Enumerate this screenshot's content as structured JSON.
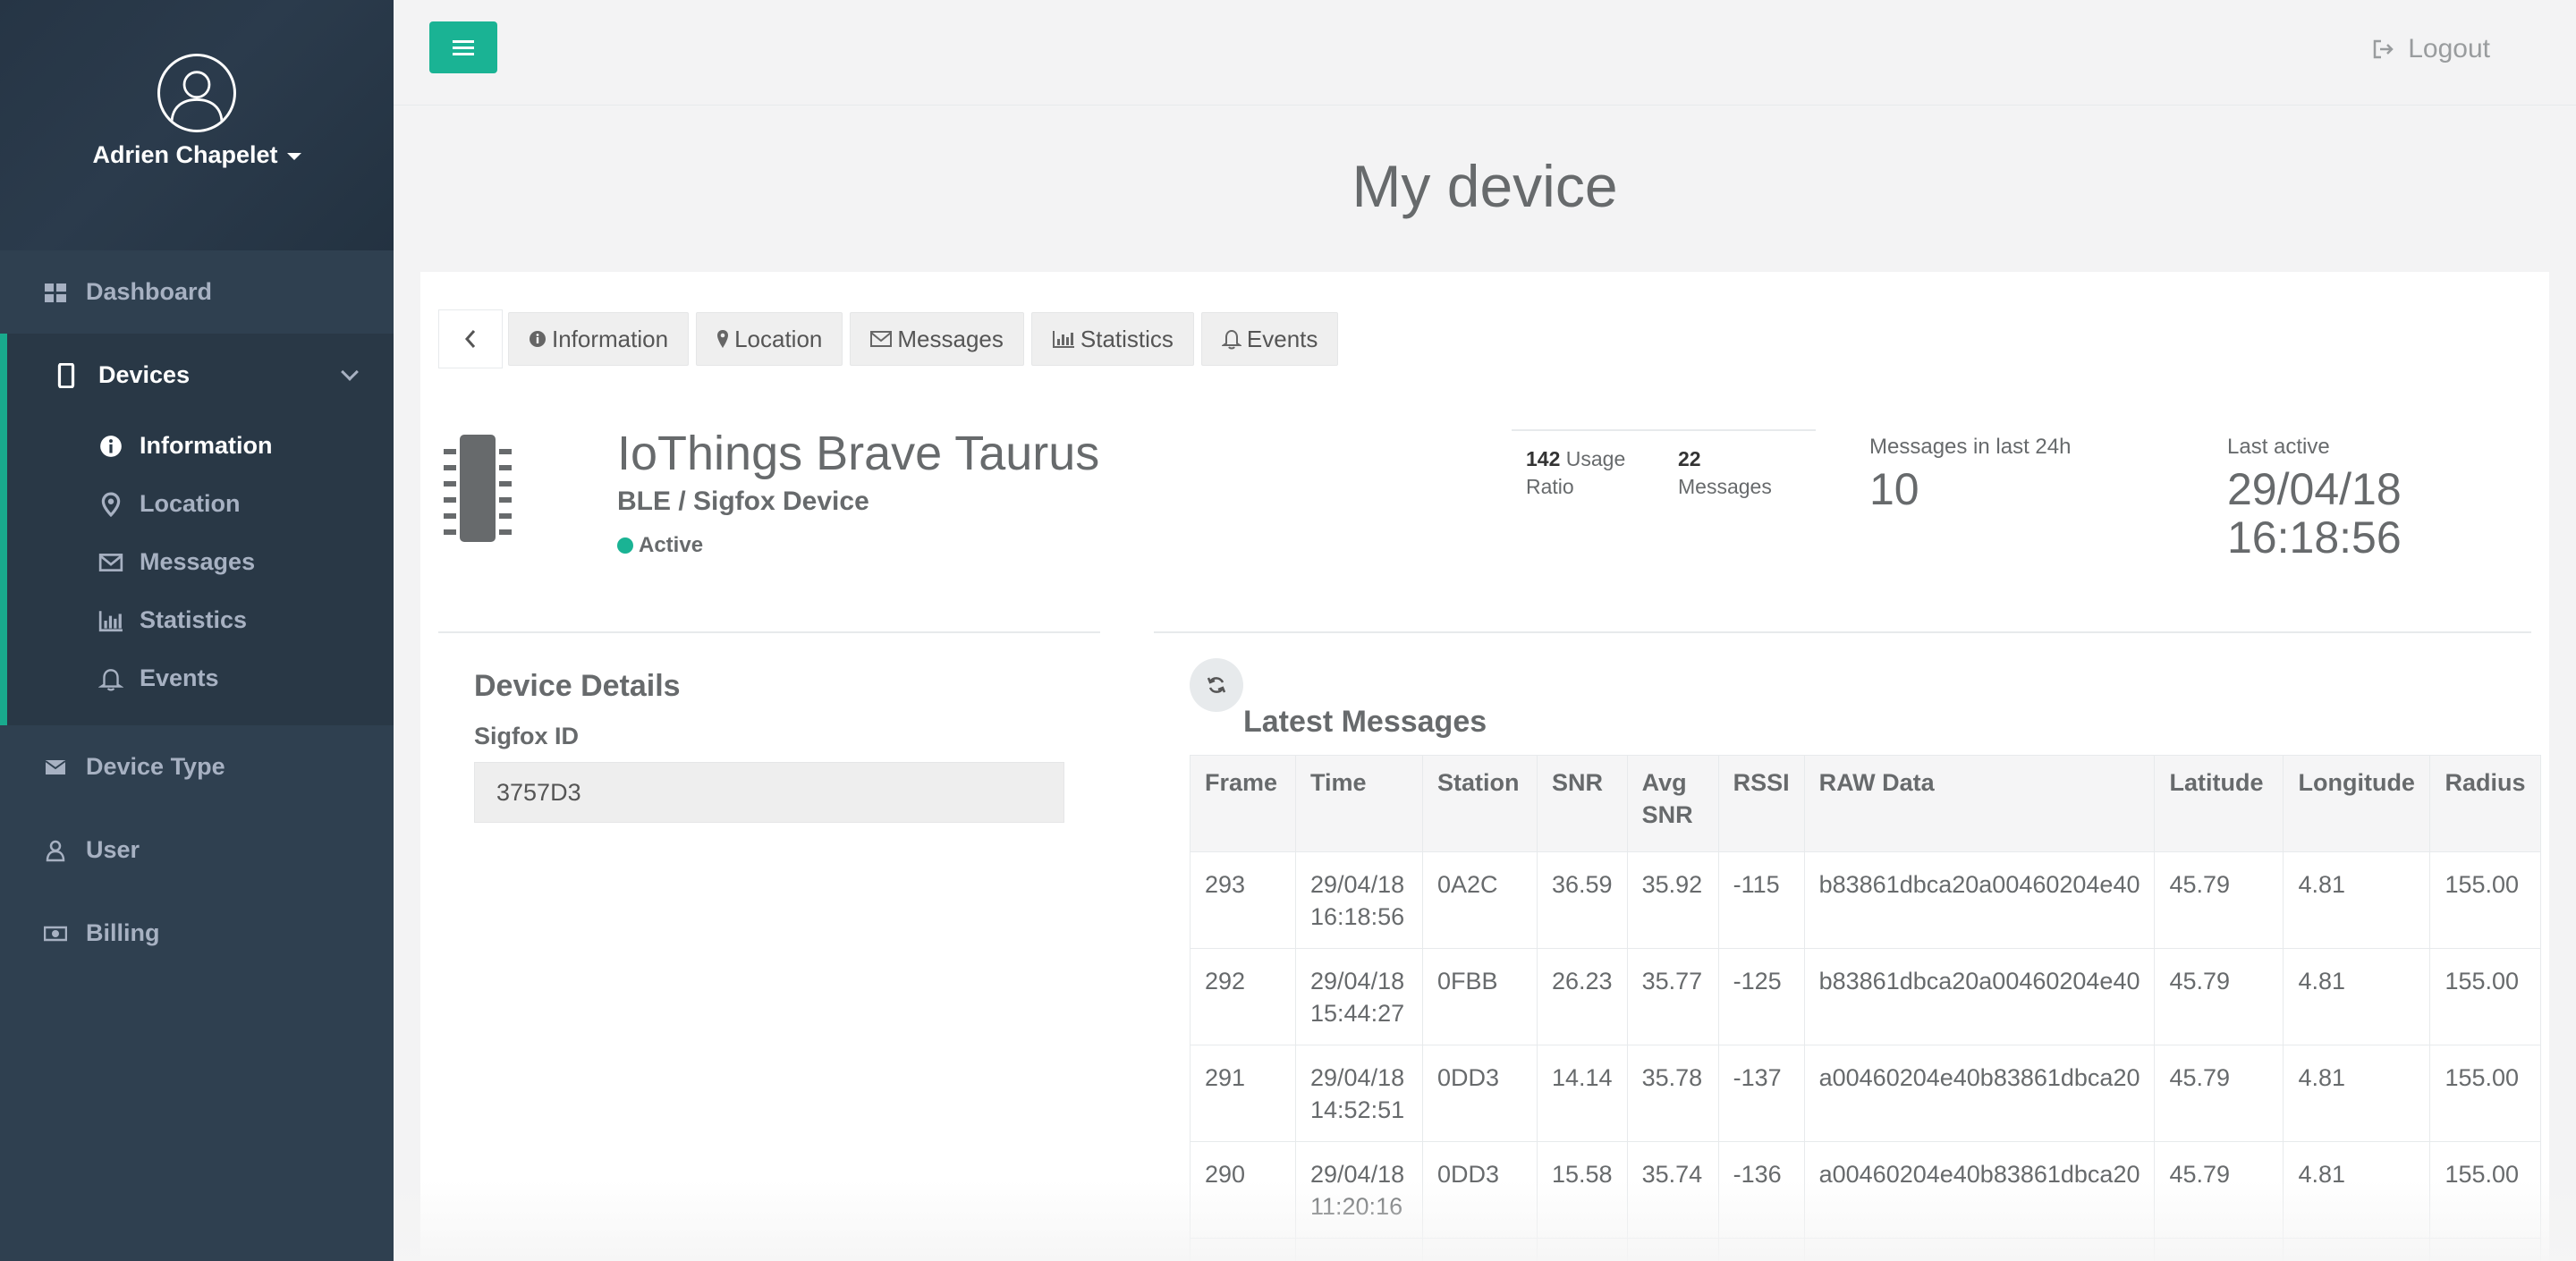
{
  "profile": {
    "name": "Adrien Chapelet"
  },
  "sidebar": {
    "items": [
      {
        "label": "Dashboard",
        "icon": "dashboard-icon"
      },
      {
        "label": "Devices",
        "icon": "mobile-icon"
      },
      {
        "label": "Device Type",
        "icon": "envelope-icon"
      },
      {
        "label": "User",
        "icon": "user-icon"
      },
      {
        "label": "Billing",
        "icon": "money-icon"
      }
    ],
    "sub_items": [
      {
        "label": "Information",
        "icon": "info-circle-icon"
      },
      {
        "label": "Location",
        "icon": "map-marker-icon"
      },
      {
        "label": "Messages",
        "icon": "envelope-icon"
      },
      {
        "label": "Statistics",
        "icon": "bar-chart-icon"
      },
      {
        "label": "Events",
        "icon": "bell-icon"
      }
    ]
  },
  "topbar": {
    "logout_label": "Logout"
  },
  "page": {
    "title": "My device"
  },
  "tabs": [
    {
      "label": "Information",
      "icon": "info-circle-icon"
    },
    {
      "label": "Location",
      "icon": "map-marker-icon"
    },
    {
      "label": "Messages",
      "icon": "envelope-icon"
    },
    {
      "label": "Statistics",
      "icon": "bar-chart-icon"
    },
    {
      "label": "Events",
      "icon": "bell-icon"
    }
  ],
  "device": {
    "name": "IoThings Brave Taurus",
    "type": "BLE / Sigfox Device",
    "status": "Active"
  },
  "stats": {
    "usage_value": "142",
    "usage_label_1": "Usage",
    "usage_label_2": "Ratio",
    "messages_value": "22",
    "messages_label": "Messages",
    "msg24_label": "Messages in last 24h",
    "msg24_value": "10",
    "last_active_label": "Last active",
    "last_active_date": "29/04/18",
    "last_active_time": "16:18:56"
  },
  "details": {
    "title": "Device Details",
    "sigfox_label": "Sigfox ID",
    "sigfox_value": "3757D3"
  },
  "latest": {
    "title": "Latest Messages",
    "headers": [
      "Frame",
      "Time",
      "Station",
      "SNR",
      "Avg SNR",
      "RSSI",
      "RAW Data",
      "Latitude",
      "Longitude",
      "Radius"
    ],
    "rows": [
      [
        "293",
        "29/04/18 16:18:56",
        "0A2C",
        "36.59",
        "35.92",
        "-115",
        "b83861dbca20a00460204e40",
        "45.79",
        "4.81",
        "155.00"
      ],
      [
        "292",
        "29/04/18 15:44:27",
        "0FBB",
        "26.23",
        "35.77",
        "-125",
        "b83861dbca20a00460204e40",
        "45.79",
        "4.81",
        "155.00"
      ],
      [
        "291",
        "29/04/18 14:52:51",
        "0DD3",
        "14.14",
        "35.78",
        "-137",
        "a00460204e40b83861dbca20",
        "45.79",
        "4.81",
        "155.00"
      ],
      [
        "290",
        "29/04/18 11:20:16",
        "0DD3",
        "15.58",
        "35.74",
        "-136",
        "a00460204e40b83861dbca20",
        "45.79",
        "4.81",
        "155.00"
      ]
    ]
  },
  "colors": {
    "accent": "#1ab394",
    "sidebar": "#2f4050",
    "sidebar_text": "#a7b1c2"
  }
}
